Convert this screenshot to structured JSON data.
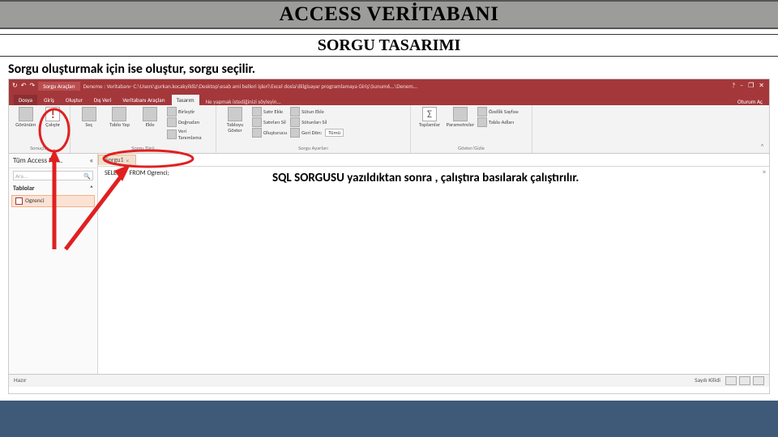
{
  "slide": {
    "title": "ACCESS VERİTABANI",
    "subtitle": "SORGU TASARIMI",
    "lead": "Sorgu oluşturmak için ise oluştur, sorgu seçilir.",
    "note": "SQL SORGUSU yazıldıktan sonra , çalıştıra basılarak çalıştırılır."
  },
  "access": {
    "qat": {
      "reload": "↻",
      "undo": "↶",
      "redo": "↷"
    },
    "titlebar": {
      "context_tab": "Sorgu Araçları",
      "path": "Deneme : Veritabanı- C:\\Users\\gurkan.kocakyildiz\\Desktop\\esab ami belleri işleri\\Excel dosla\\Bilgisayar programlamaya Giriş\\Sunum6...\\Denem..."
    },
    "window": {
      "help": "?",
      "min": "–",
      "restore": "❐",
      "close": "✕"
    },
    "tabs": {
      "dosya": "Dosya",
      "giris": "Giriş",
      "olustur": "Oluştur",
      "disveri": "Dış Veri",
      "vtaraclari": "Veritabanı Araçları",
      "tasarim": "Tasarım",
      "tell": "Ne yapmak istediğinizi söyleyin...",
      "signin": "Oturum Aç"
    },
    "ribbon": {
      "grp_results": "Sonuçlar",
      "view": "Görünüm",
      "run": "Çalıştır",
      "grp_querytype": "Sorgu Türü",
      "select": "Seç",
      "maketable": "Tablo Yap",
      "append": "Ekle",
      "qt_more1": "Birleştir",
      "qt_more2": "Doğrudan",
      "qt_more3": "Veri Tanımlama",
      "grp_querysetup": "Sorgu Ayarları",
      "showtable": "Tabloyu Göster",
      "insrows": "Satır Ekle",
      "delrows": "Satırları Sil",
      "builder": "Oluşturucu",
      "inscols": "Sütun Ekle",
      "delcols": "Sütunları Sil",
      "return": "Geri Dön:",
      "return_val": "Tümü",
      "totals": "Toplamlar",
      "params": "Parametreler",
      "grp_showhide": "Göster/Gizle",
      "propsheet": "Özellik Sayfası",
      "tablenames": "Tablo Adları",
      "collapse": "˄"
    },
    "nav": {
      "header": "Tüm Access Ne...",
      "chevron": "«",
      "search": "Ara...",
      "category": "Tablolar",
      "cat_chevron": "˄",
      "item1": "Ogrenci"
    },
    "doc": {
      "tab": "Sorgu1",
      "tab_close": "×",
      "sql": "SELECT * FROM Ogrenci;",
      "pane_close": "×"
    },
    "status": {
      "left": "Hazır",
      "right": "Sayılı Kilidi"
    }
  }
}
